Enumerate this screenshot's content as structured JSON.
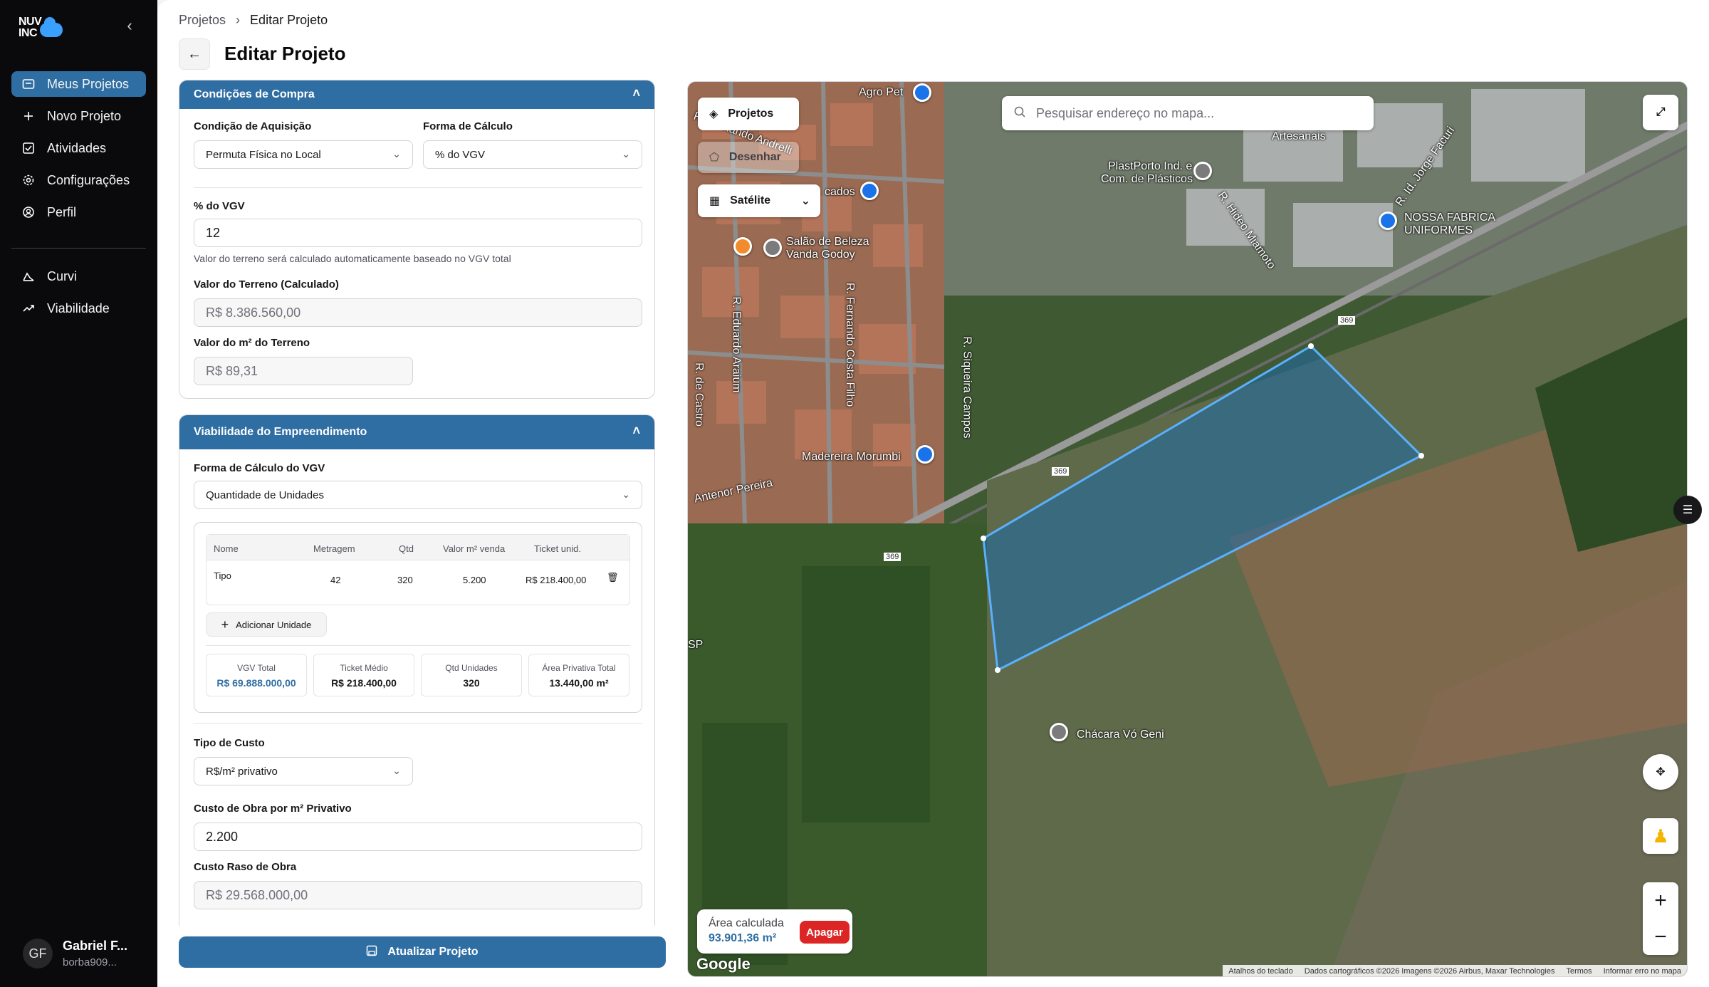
{
  "sidebar": {
    "logo_line1": "NUV",
    "logo_line2": "INC",
    "items": [
      {
        "label": "Meus Projetos",
        "icon": "folder-icon",
        "active": true
      },
      {
        "label": "Novo Projeto",
        "icon": "plus-icon"
      },
      {
        "label": "Atividades",
        "icon": "checklist-icon"
      },
      {
        "label": "Configurações",
        "icon": "gear-icon"
      },
      {
        "label": "Perfil",
        "icon": "user-circle-icon"
      },
      {
        "label": "Curvi",
        "icon": "triangle-chart-icon"
      },
      {
        "label": "Viabilidade",
        "icon": "trend-up-icon"
      }
    ],
    "user": {
      "initials": "GF",
      "name": "Gabriel F...",
      "email": "borba909..."
    }
  },
  "header": {
    "breadcrumb": [
      "Projetos",
      "Editar Projeto"
    ],
    "title": "Editar Projeto"
  },
  "compra": {
    "title": "Condições de Compra",
    "aquisicao_label": "Condição de Aquisição",
    "aquisicao_value": "Permuta Física no Local",
    "calculo_label": "Forma de Cálculo",
    "calculo_value": "% do VGV",
    "vgv_pct_label": "% do VGV",
    "vgv_pct_value": "12",
    "hint": "Valor do terreno será calculado automaticamente baseado no VGV total",
    "terreno_label": "Valor do Terreno (Calculado)",
    "terreno_value": "R$ 8.386.560,00",
    "m2_label": "Valor do m² do Terreno",
    "m2_value": "R$ 89,31"
  },
  "viabilidade": {
    "title": "Viabilidade do Empreendimento",
    "vgv_form_label": "Forma de Cálculo do VGV",
    "vgv_form_value": "Quantidade de Unidades",
    "table_headers": [
      "Nome",
      "Metragem",
      "Qtd",
      "Valor m² venda",
      "Ticket unid."
    ],
    "rows": [
      {
        "nome": "Tipo",
        "metragem": "42",
        "qtd": "320",
        "valor": "5.200",
        "ticket": "R$ 218.400,00"
      }
    ],
    "add_label": "Adicionar Unidade",
    "stats": [
      {
        "label": "VGV Total",
        "value": "R$ 69.888.000,00"
      },
      {
        "label": "Ticket Médio",
        "value": "R$ 218.400,00"
      },
      {
        "label": "Qtd Unidades",
        "value": "320"
      },
      {
        "label": "Área Privativa Total",
        "value": "13.440,00 m²"
      }
    ],
    "custo_tipo_label": "Tipo de Custo",
    "custo_tipo_value": "R$/m² privativo",
    "custo_obra_label": "Custo de Obra por m² Privativo",
    "custo_obra_value": "2.200",
    "custo_raso_label": "Custo Raso de Obra",
    "custo_raso_value": "R$ 29.568.000,00"
  },
  "update_label": "Atualizar Projeto",
  "map": {
    "projetos_label": "Projetos",
    "desenhar_label": "Desenhar",
    "layer_label": "Satélite",
    "search_placeholder": "Pesquisar endereço no mapa...",
    "labels": [
      "Agro Pet",
      "R. Fernando Andrelli",
      "Artesanais",
      "PlastPorto Ind. e",
      "Com. de Plásticos",
      "R. Id. Jorge Facuri",
      "NOSSA FABRICA",
      "UNIFORMES",
      "R. Hideo Miamoto",
      "Salão de Beleza",
      "Vanda Godoy",
      "R. Eduardo Araium",
      "R. Fernando Costa Filho",
      "R. Siqueira Campos",
      "Madereira Morumbi",
      "Antenor Pereira",
      "Chácara Vó Geni",
      "369",
      "369",
      "369",
      "SP",
      "cados",
      "R. de Castro"
    ],
    "area_label": "Área calculada",
    "area_value": "93.901,36 m²",
    "delete_label": "Apagar",
    "google": "Google",
    "attribution": [
      "Atalhos do teclado",
      "Dados cartográficos ©2026 Imagens ©2026 Airbus, Maxar Technologies",
      "Termos",
      "Informar erro no mapa"
    ],
    "zoom_in": "+",
    "zoom_out": "−"
  }
}
